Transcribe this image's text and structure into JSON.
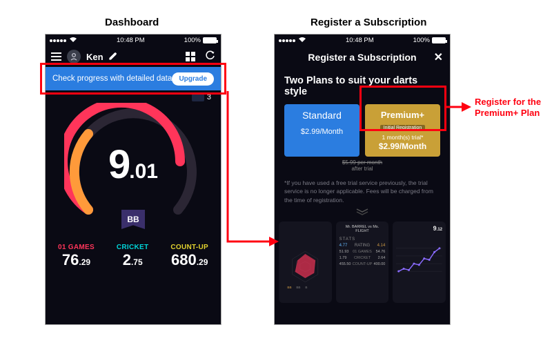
{
  "headings": {
    "dashboard": "Dashboard",
    "subscription": "Register a Subscription"
  },
  "status": {
    "carrier_dots": 5,
    "wifi": true,
    "time": "10:48 PM",
    "battery_pct": "100%"
  },
  "dashboard": {
    "user_name": "Ken",
    "banner_text": "Check progress with detailed data",
    "upgrade_label": "Upgrade",
    "ticket_count": "3",
    "score_main": "9",
    "score_dec": ".01",
    "ribbon": "BB",
    "stats": [
      {
        "label": "01 GAMES",
        "value_main": "76",
        "value_dec": ".29",
        "color": "c-red"
      },
      {
        "label": "CRICKET",
        "value_main": "2",
        "value_dec": ".75",
        "color": "c-cyan"
      },
      {
        "label": "COUNT-UP",
        "value_main": "680",
        "value_dec": ".29",
        "color": "c-yel"
      }
    ]
  },
  "subscription": {
    "header": "Register a Subscription",
    "close": "✕",
    "title": "Two Plans to suit your darts style",
    "standard": {
      "name": "Standard",
      "price": "$2.99/Month"
    },
    "premium": {
      "name": "Premium+",
      "tag": "Initial Registration",
      "trial": "1 month(s) trial*",
      "price": "$2.99/Month"
    },
    "after_strike": "$5.99 per month",
    "after_text": "after trial",
    "disclaimer": "*If you have used a free trial service previously, the trial service is no longer applicable. Fees will be charged from the time of registration.",
    "previews": {
      "p2": {
        "names": "Mr. BARREL   vs   Ms. FLIGHT",
        "stats_hdr": "STATS",
        "rows": [
          [
            "4.77",
            "RATING",
            "4.14"
          ],
          [
            "51.93",
            "01 GAMES",
            "54.76"
          ],
          [
            "1.79",
            "CRICKET",
            "2.64"
          ],
          [
            "455.50",
            "COUNT-UP",
            "400.00"
          ]
        ]
      },
      "p3": {
        "score_main": "9",
        "score_dec": ".12"
      }
    }
  },
  "callout": {
    "text1": "Register for the",
    "text2": "Premium+ Plan"
  }
}
